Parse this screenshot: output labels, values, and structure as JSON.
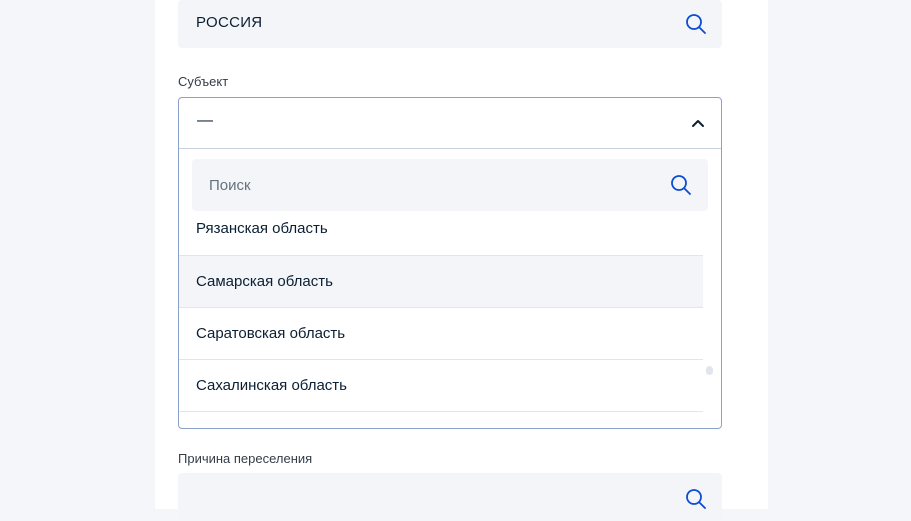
{
  "country_field": {
    "value": "РОССИЯ",
    "icon": "search-icon"
  },
  "subject": {
    "label": "Субъект",
    "selected": "—",
    "search_placeholder": "Поиск",
    "options": [
      "Рязанская область",
      "Самарская область",
      "Саратовская область",
      "Сахалинская область"
    ],
    "hovered_option": "Самарская область"
  },
  "reason": {
    "label": "Причина переселения",
    "icon": "search-icon"
  },
  "colors": {
    "accent": "#0d4cd3",
    "border": "#8aa2c8",
    "field_bg": "#f3f5f9",
    "page_bg": "#f4f6fa"
  }
}
